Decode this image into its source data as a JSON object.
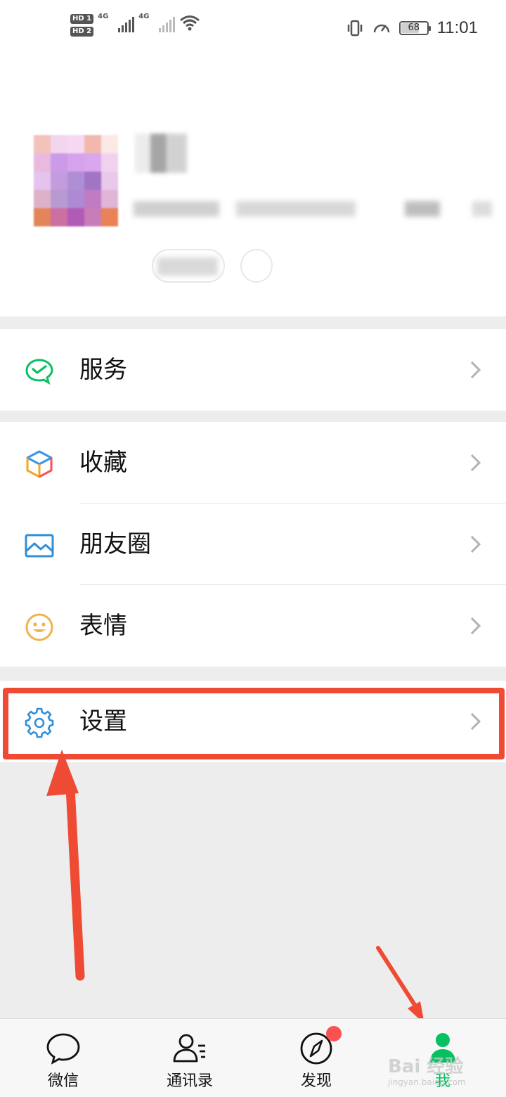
{
  "status_bar": {
    "hd1": "HD 1",
    "hd2": "HD 2",
    "network1": "4G",
    "network2": "4G",
    "battery": "68",
    "time": "11:01"
  },
  "menu": {
    "services": {
      "label": "服务",
      "icon": "wechat-pay-icon"
    },
    "favorites": {
      "label": "收藏",
      "icon": "cube-icon"
    },
    "moments": {
      "label": "朋友圈",
      "icon": "picture-icon"
    },
    "stickers": {
      "label": "表情",
      "icon": "smiley-icon"
    },
    "settings": {
      "label": "设置",
      "icon": "gear-icon"
    }
  },
  "tabs": [
    {
      "label": "微信",
      "icon": "chat-bubble-icon"
    },
    {
      "label": "通讯录",
      "icon": "contacts-icon"
    },
    {
      "label": "发现",
      "icon": "compass-icon"
    },
    {
      "label": "我",
      "icon": "person-icon"
    }
  ],
  "watermark": {
    "text": "Bai 经验",
    "sub": "jingyan.baidu.com"
  },
  "colors": {
    "accent": "#07c160",
    "annotation": "#ef4a34",
    "badge": "#fa5151"
  }
}
